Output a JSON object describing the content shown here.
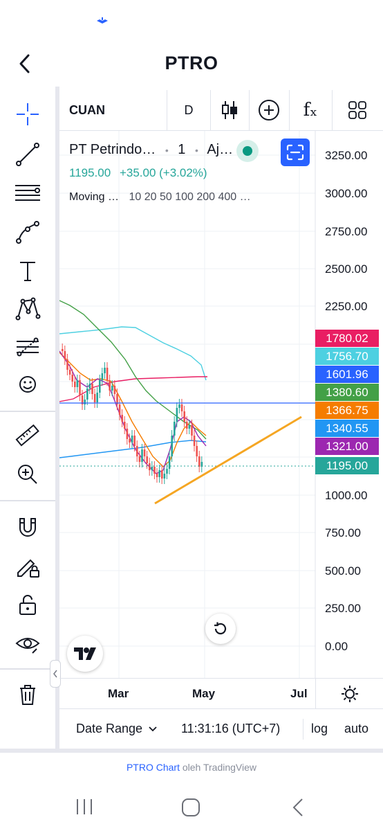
{
  "header": {
    "title": "PTRO"
  },
  "toolbar": {
    "symbol": "CUAN",
    "interval": "D",
    "fx_label": "fₓ"
  },
  "legend": {
    "name": "PT Petrindo…",
    "interval": "1",
    "exchange": "Aj…",
    "price": "1195.00",
    "change": "+35.00 (+3.02%)",
    "ma_label": "Moving …",
    "ma_params": "10 20 50 100 200 400 …"
  },
  "y_axis": {
    "labels": [
      "3250.00",
      "3000.00",
      "2750.00",
      "2500.00",
      "2250.00",
      "1000.00",
      "750.00",
      "500.00",
      "250.00",
      "0.00"
    ]
  },
  "price_tags": [
    {
      "value": "1780.02",
      "color": "#e91e63"
    },
    {
      "value": "1756.70",
      "color": "#4dd0e1"
    },
    {
      "value": "1601.96",
      "color": "#2962ff"
    },
    {
      "value": "1380.60",
      "color": "#43a047"
    },
    {
      "value": "1366.75",
      "color": "#f57c00"
    },
    {
      "value": "1340.55",
      "color": "#2196f3"
    },
    {
      "value": "1321.00",
      "color": "#9c27b0"
    },
    {
      "value": "1195.00",
      "color": "#26a69a"
    }
  ],
  "x_axis": {
    "labels": [
      "Mar",
      "May",
      "Jul"
    ]
  },
  "bottom_bar": {
    "date_range": "Date Range",
    "time": "11:31:16 (UTC+7)",
    "log": "log",
    "auto": "auto"
  },
  "attribution": {
    "symbol_link": "PTRO Chart",
    "rest": " oleh TradingView"
  },
  "colors": {
    "accent": "#2962ff",
    "up": "#26a69a",
    "down": "#ef5350",
    "trendline": "#f5a623"
  }
}
